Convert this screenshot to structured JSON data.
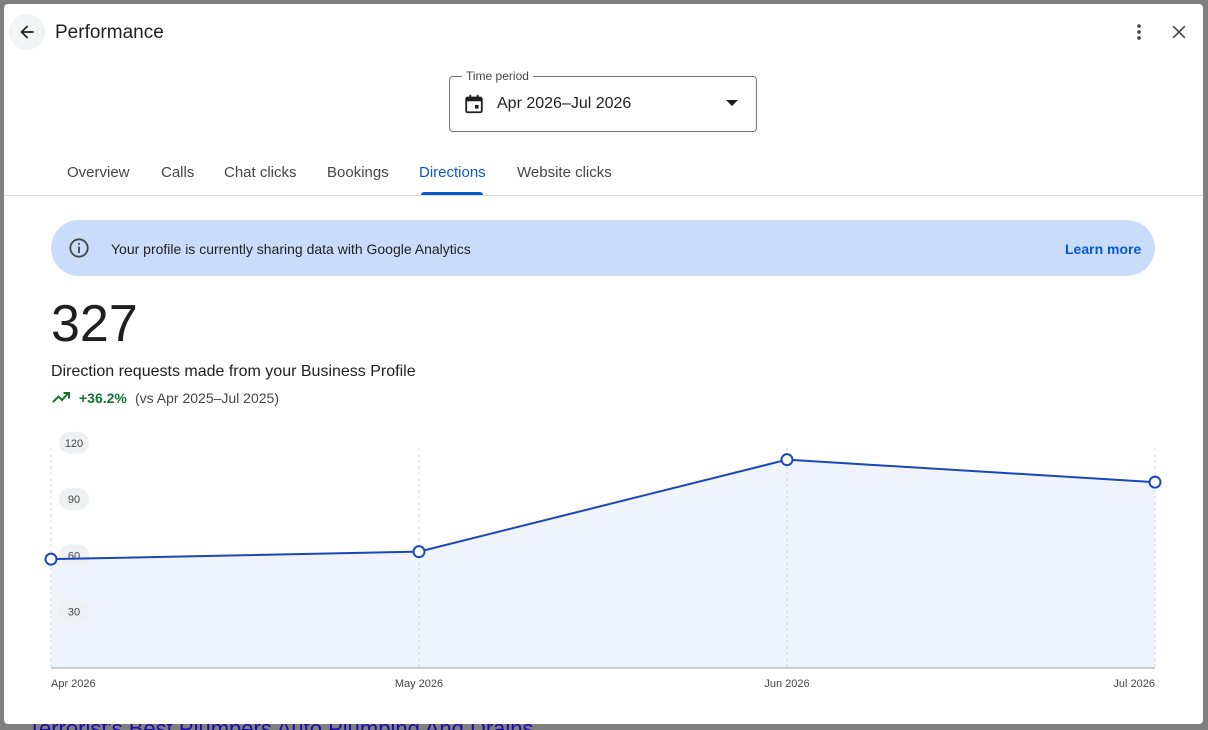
{
  "header": {
    "title": "Performance",
    "back_icon": "arrow-back-icon",
    "menu_icon": "more-vert-icon",
    "close_icon": "close-icon"
  },
  "time_period": {
    "label": "Time period",
    "value": "Apr 2026–Jul 2026",
    "icon": "calendar-icon"
  },
  "tabs": [
    {
      "label": "Overview",
      "active": false
    },
    {
      "label": "Calls",
      "active": false
    },
    {
      "label": "Chat clicks",
      "active": false
    },
    {
      "label": "Bookings",
      "active": false
    },
    {
      "label": "Directions",
      "active": true
    },
    {
      "label": "Website clicks",
      "active": false
    }
  ],
  "banner": {
    "text": "Your profile is currently sharing data with Google Analytics",
    "link": "Learn more",
    "icon": "info-icon",
    "color": "#c9dcfa"
  },
  "metric": {
    "value": "327",
    "label": "Direction requests made from your Business Profile",
    "change": "+36.2%",
    "compare": "(vs Apr 2025–Jul 2025)",
    "trend_icon": "trending-up-icon",
    "change_color": "#137333"
  },
  "colors": {
    "accent": "#0b57d0",
    "line": "#1a47b8",
    "area": "#eef3fc"
  },
  "chart_data": {
    "type": "area",
    "x": [
      "Apr 2026",
      "May 2026",
      "Jun 2026",
      "Jul 2026"
    ],
    "series": [
      {
        "values": [
          58,
          62,
          111,
          99
        ]
      }
    ],
    "y_ticks": [
      30,
      60,
      90,
      120
    ],
    "ylim": [
      0,
      130
    ],
    "grid": "vertical dashed"
  },
  "background": {
    "link_text": "Terrorist's Best Plumbers Auto Plumbing And Drains"
  }
}
